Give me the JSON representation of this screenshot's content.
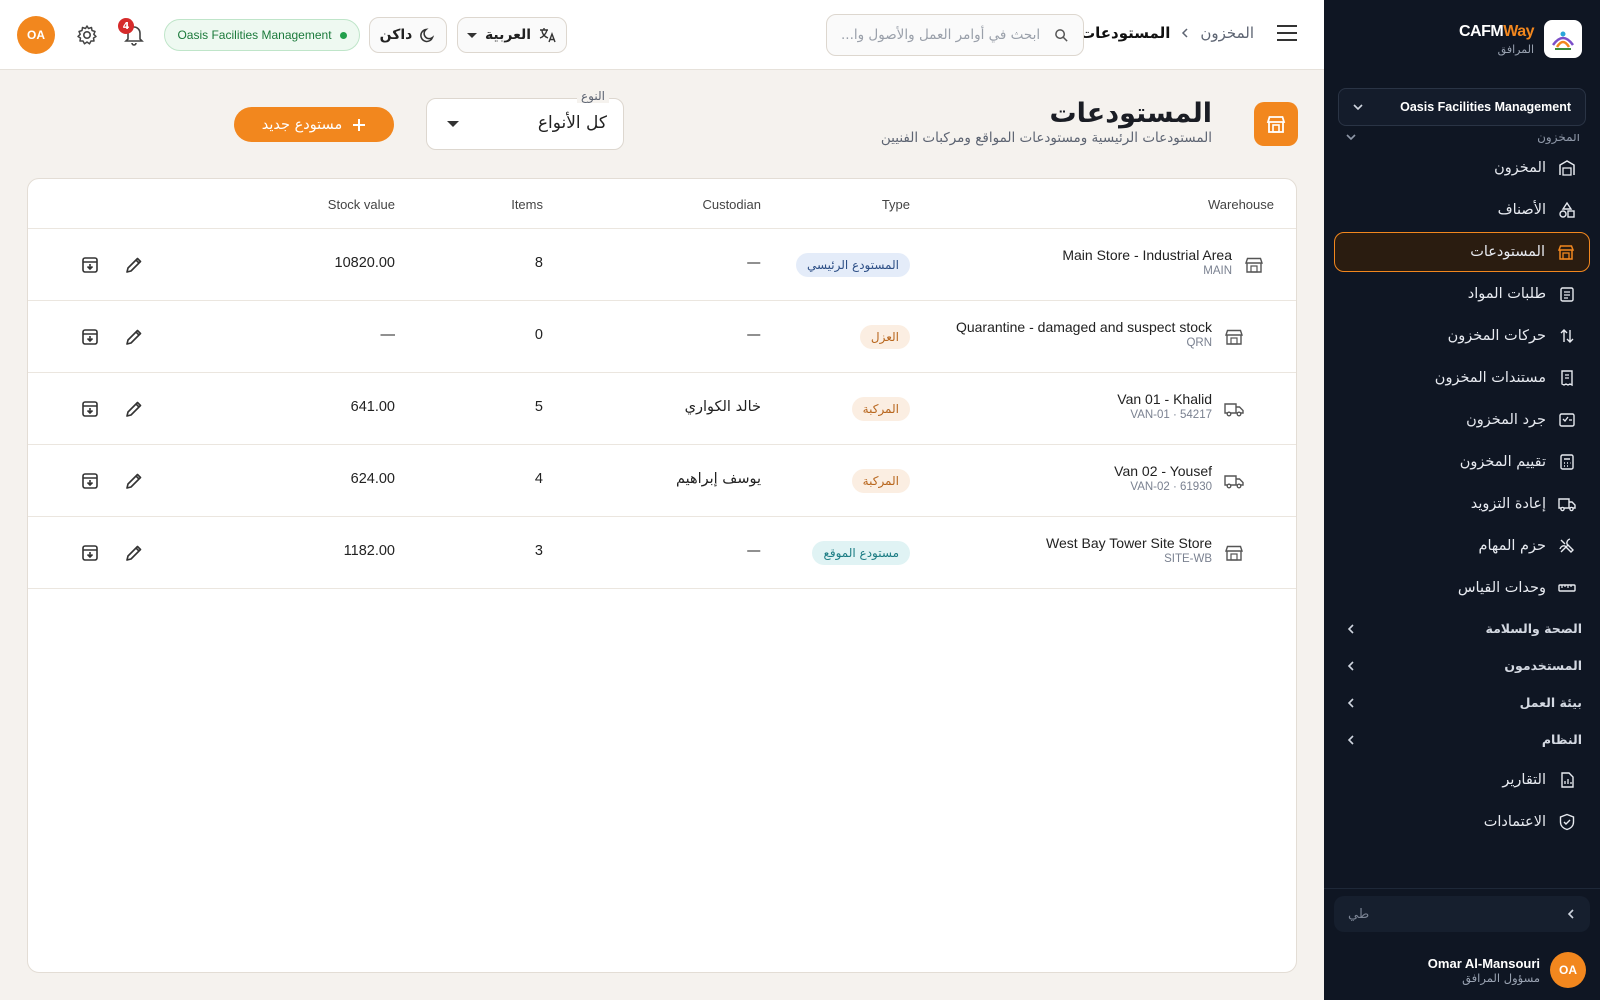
{
  "app": {
    "brand_main": "CAFM",
    "brand_accent": "Way",
    "brand_sub": "المرافق",
    "accent_color": "#f2871e"
  },
  "sidebar": {
    "org": "Oasis Facilities Management",
    "section_cut": "المخزون",
    "items": [
      {
        "label": "المخزون",
        "icon": "warehouse-icon"
      },
      {
        "label": "الأصناف",
        "icon": "shapes-icon"
      },
      {
        "label": "المستودعات",
        "icon": "store-icon",
        "active": true
      },
      {
        "label": "طلبات المواد",
        "icon": "clipboard-icon"
      },
      {
        "label": "حركات المخزون",
        "icon": "arrows-updown-icon"
      },
      {
        "label": "مستندات المخزون",
        "icon": "receipt-icon"
      },
      {
        "label": "جرد المخزون",
        "icon": "checklist-icon"
      },
      {
        "label": "تقييم المخزون",
        "icon": "calculator-icon"
      },
      {
        "label": "إعادة التزويد",
        "icon": "truck-icon"
      },
      {
        "label": "حزم المهام",
        "icon": "tools-icon"
      },
      {
        "label": "وحدات القياس",
        "icon": "ruler-icon"
      }
    ],
    "groups": [
      "الصحة والسلامة",
      "المستخدمون",
      "بيئة العمل",
      "النظام"
    ],
    "bottom_items": [
      {
        "label": "التقارير",
        "icon": "report-icon"
      },
      {
        "label": "الاعتمادات",
        "icon": "shield-check-icon"
      }
    ],
    "search_placeholder": "طي",
    "user": {
      "initials": "OA",
      "name": "Omar Al-Mansouri",
      "role": "مسؤول المرافق"
    }
  },
  "topbar": {
    "breadcrumb_parent": "المخزون",
    "breadcrumb_current": "المستودعات",
    "search_placeholder": "ابحث في أوامر العمل والأصول وا...",
    "language": "العربية",
    "theme": "داكن",
    "org_pill": "Oasis Facilities Management",
    "notifications": "4",
    "avatar": "OA"
  },
  "page": {
    "title": "المستودعات",
    "subtitle": "المستودعات الرئيسية ومستودعات المواقع ومركبات الفنيين",
    "filter_label": "النوع",
    "filter_value": "كل الأنواع",
    "new_button": "مستودع جديد"
  },
  "table": {
    "headers": {
      "warehouse": "Warehouse",
      "type": "Type",
      "custodian": "Custodian",
      "items": "Items",
      "stock_value": "Stock value"
    },
    "rows": [
      {
        "name": "Main Store - Industrial Area",
        "code": "MAIN",
        "icon": "warehouse",
        "type": "المستودع الرئيسي",
        "type_style": "blue",
        "custodian": "—",
        "items": "8",
        "value": "10820.00"
      },
      {
        "name": "Quarantine - damaged and suspect stock",
        "code": "QRN",
        "icon": "warehouse",
        "type": "العزل",
        "type_style": "amber",
        "custodian": "—",
        "items": "0",
        "value": "—"
      },
      {
        "name": "Van 01 - Khalid",
        "code": "VAN-01 · 54217",
        "icon": "truck",
        "type": "المركبة",
        "type_style": "amber",
        "custodian": "خالد الكواري",
        "items": "5",
        "value": "641.00"
      },
      {
        "name": "Van 02 - Yousef",
        "code": "VAN-02 · 61930",
        "icon": "truck",
        "type": "المركبة",
        "type_style": "amber",
        "custodian": "يوسف إبراهيم",
        "items": "4",
        "value": "624.00"
      },
      {
        "name": "West Bay Tower Site Store",
        "code": "SITE-WB",
        "icon": "warehouse",
        "type": "مستودع الموقع",
        "type_style": "teal",
        "custodian": "—",
        "items": "3",
        "value": "1182.00"
      }
    ]
  }
}
